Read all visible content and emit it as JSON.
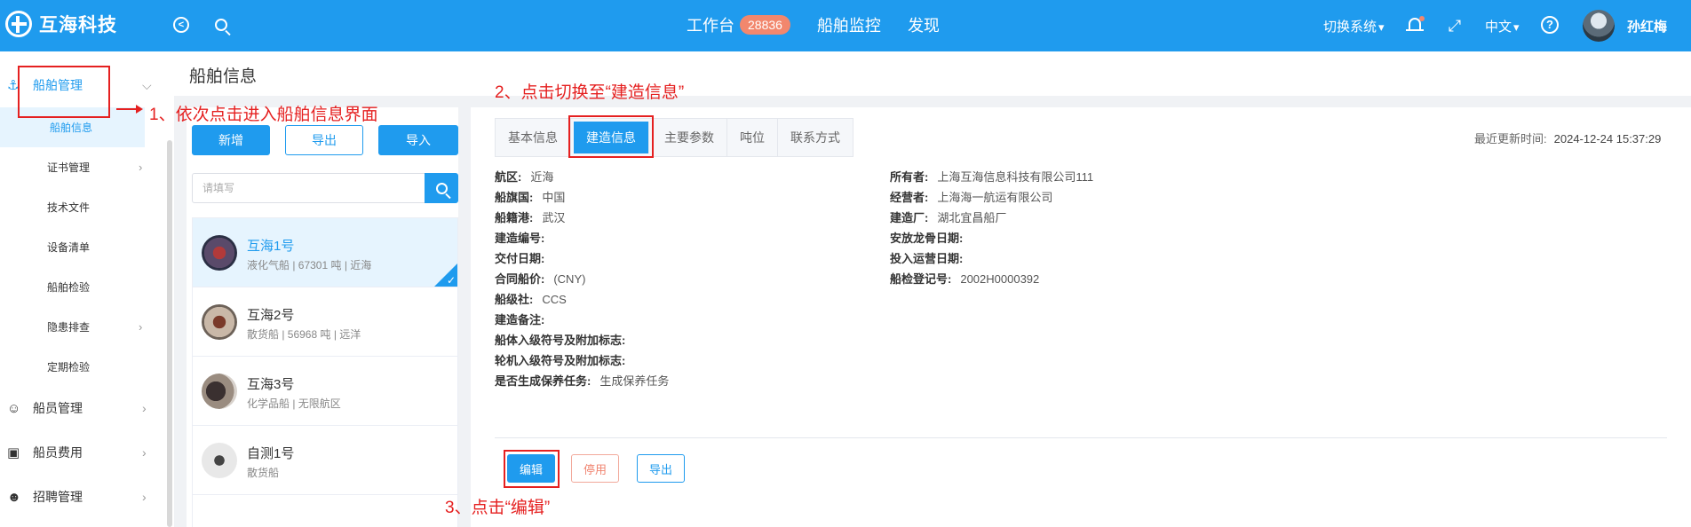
{
  "app": {
    "logo_text": "互海科技"
  },
  "topnav": {
    "workbench_label": "工作台",
    "workbench_badge": "28836",
    "items": [
      "船舶监控",
      "发现"
    ]
  },
  "topright": {
    "switch_system": "切换系统",
    "language": "中文",
    "username": "孙红梅"
  },
  "sidebar": {
    "groups": [
      {
        "label": "船舶管理",
        "icon": "anchor-icon"
      },
      {
        "label": "船员管理",
        "icon": "user-icon"
      },
      {
        "label": "船员费用",
        "icon": "wallet-icon"
      },
      {
        "label": "招聘管理",
        "icon": "recruit-icon"
      }
    ],
    "items": [
      "船舶信息",
      "证书管理",
      "技术文件",
      "设备清单",
      "船舶检验",
      "隐患排查",
      "定期检验"
    ]
  },
  "page": {
    "title": "船舶信息"
  },
  "list": {
    "buttons": {
      "add": "新增",
      "export": "导出",
      "import": "导入"
    },
    "search_placeholder": "请填写",
    "ships": [
      {
        "name": "互海1号",
        "meta": "液化气船 | 67301 吨 | 近海"
      },
      {
        "name": "互海2号",
        "meta": "散货船 | 56968 吨 | 远洋"
      },
      {
        "name": "互海3号",
        "meta": "化学品船 | 无限航区"
      },
      {
        "name": "自测1号",
        "meta": "散货船"
      }
    ]
  },
  "detail": {
    "tabs": [
      "基本信息",
      "建造信息",
      "主要参数",
      "吨位",
      "联系方式"
    ],
    "updated_label": "最近更新时间:",
    "updated_value": "2024-12-24 15:37:29",
    "left_fields": [
      {
        "k": "航区:",
        "v": "近海"
      },
      {
        "k": "船旗国:",
        "v": "中国"
      },
      {
        "k": "船籍港:",
        "v": "武汉"
      },
      {
        "k": "建造编号:",
        "v": ""
      },
      {
        "k": "交付日期:",
        "v": ""
      },
      {
        "k": "合同船价:",
        "v": "(CNY)"
      },
      {
        "k": "船级社:",
        "v": "CCS"
      },
      {
        "k": "建造备注:",
        "v": ""
      },
      {
        "k": "船体入级符号及附加标志:",
        "v": ""
      },
      {
        "k": "轮机入级符号及附加标志:",
        "v": ""
      },
      {
        "k": "是否生成保养任务:",
        "v": "生成保养任务"
      }
    ],
    "right_fields": [
      {
        "k": "所有者:",
        "v": "上海互海信息科技有限公司111"
      },
      {
        "k": "经营者:",
        "v": "上海海一航运有限公司"
      },
      {
        "k": "建造厂:",
        "v": "湖北宜昌船厂"
      },
      {
        "k": "安放龙骨日期:",
        "v": ""
      },
      {
        "k": "投入运营日期:",
        "v": ""
      },
      {
        "k": "船检登记号:",
        "v": "2002H0000392"
      }
    ],
    "buttons": {
      "edit": "编辑",
      "disable": "停用",
      "export": "导出"
    }
  },
  "annotations": {
    "step1": "1、依次点击进入船舶信息界面",
    "step2": "2、点击切换至“建造信息”",
    "step3": "3、点击“编辑”"
  }
}
